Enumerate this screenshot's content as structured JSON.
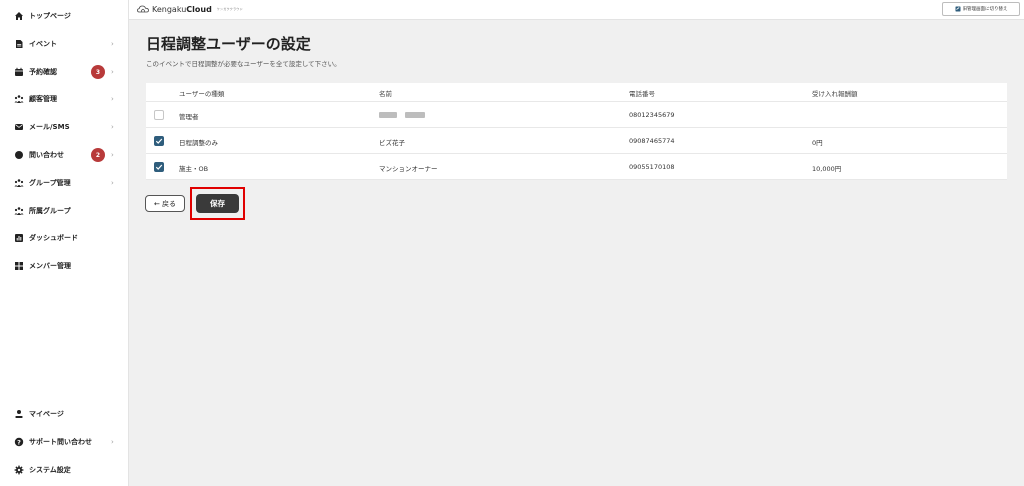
{
  "sidebar": {
    "items": [
      {
        "label": "トップページ",
        "icon": "home-icon",
        "chevron": false,
        "badge": ""
      },
      {
        "label": "イベント",
        "icon": "document-icon",
        "chevron": true,
        "badge": ""
      },
      {
        "label": "予約確認",
        "icon": "calendar-icon",
        "chevron": true,
        "badge": "3"
      },
      {
        "label": "顧客管理",
        "icon": "people-icon",
        "chevron": true,
        "badge": ""
      },
      {
        "label": "メール/SMS",
        "icon": "mail-icon",
        "chevron": true,
        "badge": ""
      },
      {
        "label": "問い合わせ",
        "icon": "chat-icon",
        "chevron": true,
        "badge": "2"
      },
      {
        "label": "グループ管理",
        "icon": "group-icon",
        "chevron": true,
        "badge": ""
      },
      {
        "label": "所属グループ",
        "icon": "group-icon",
        "chevron": false,
        "badge": ""
      },
      {
        "label": "ダッシュボード",
        "icon": "chart-icon",
        "chevron": false,
        "badge": ""
      },
      {
        "label": "メンバー管理",
        "icon": "grid-icon",
        "chevron": false,
        "badge": ""
      }
    ],
    "bottom_items": [
      {
        "label": "マイページ",
        "icon": "user-icon",
        "chevron": false
      },
      {
        "label": "サポート問い合わせ",
        "icon": "help-icon",
        "chevron": true
      },
      {
        "label": "システム設定",
        "icon": "gear-icon",
        "chevron": false
      }
    ],
    "chevron_glyph": "›"
  },
  "header": {
    "logo_text_a": "Kengaku",
    "logo_text_b": "Cloud",
    "logo_sub": "ケンガククラウド",
    "switch_label": "旧管理画面に切り替え"
  },
  "main": {
    "title": "日程調整ユーザーの設定",
    "description": "このイベントで日程調整が必要なユーザーを全て設定して下さい。",
    "columns": [
      "ユーザーの種類",
      "名前",
      "電話番号",
      "受け入れ報酬額"
    ],
    "rows": [
      {
        "checked": false,
        "type": "管理者",
        "name": "",
        "phone": "08012345679",
        "reward": ""
      },
      {
        "checked": true,
        "type": "日程調整のみ",
        "name": "ビズ花子",
        "phone": "09087465774",
        "reward": "0円"
      },
      {
        "checked": true,
        "type": "施主・OB",
        "name": "マンションオーナー",
        "phone": "09055170108",
        "reward": "10,000円"
      }
    ],
    "back_label": "← 戻る",
    "save_label": "保存"
  },
  "colors": {
    "accent": "#2f5d7c",
    "badge": "#b83a3a",
    "highlight": "#e00000",
    "save": "#3a3a3a"
  }
}
